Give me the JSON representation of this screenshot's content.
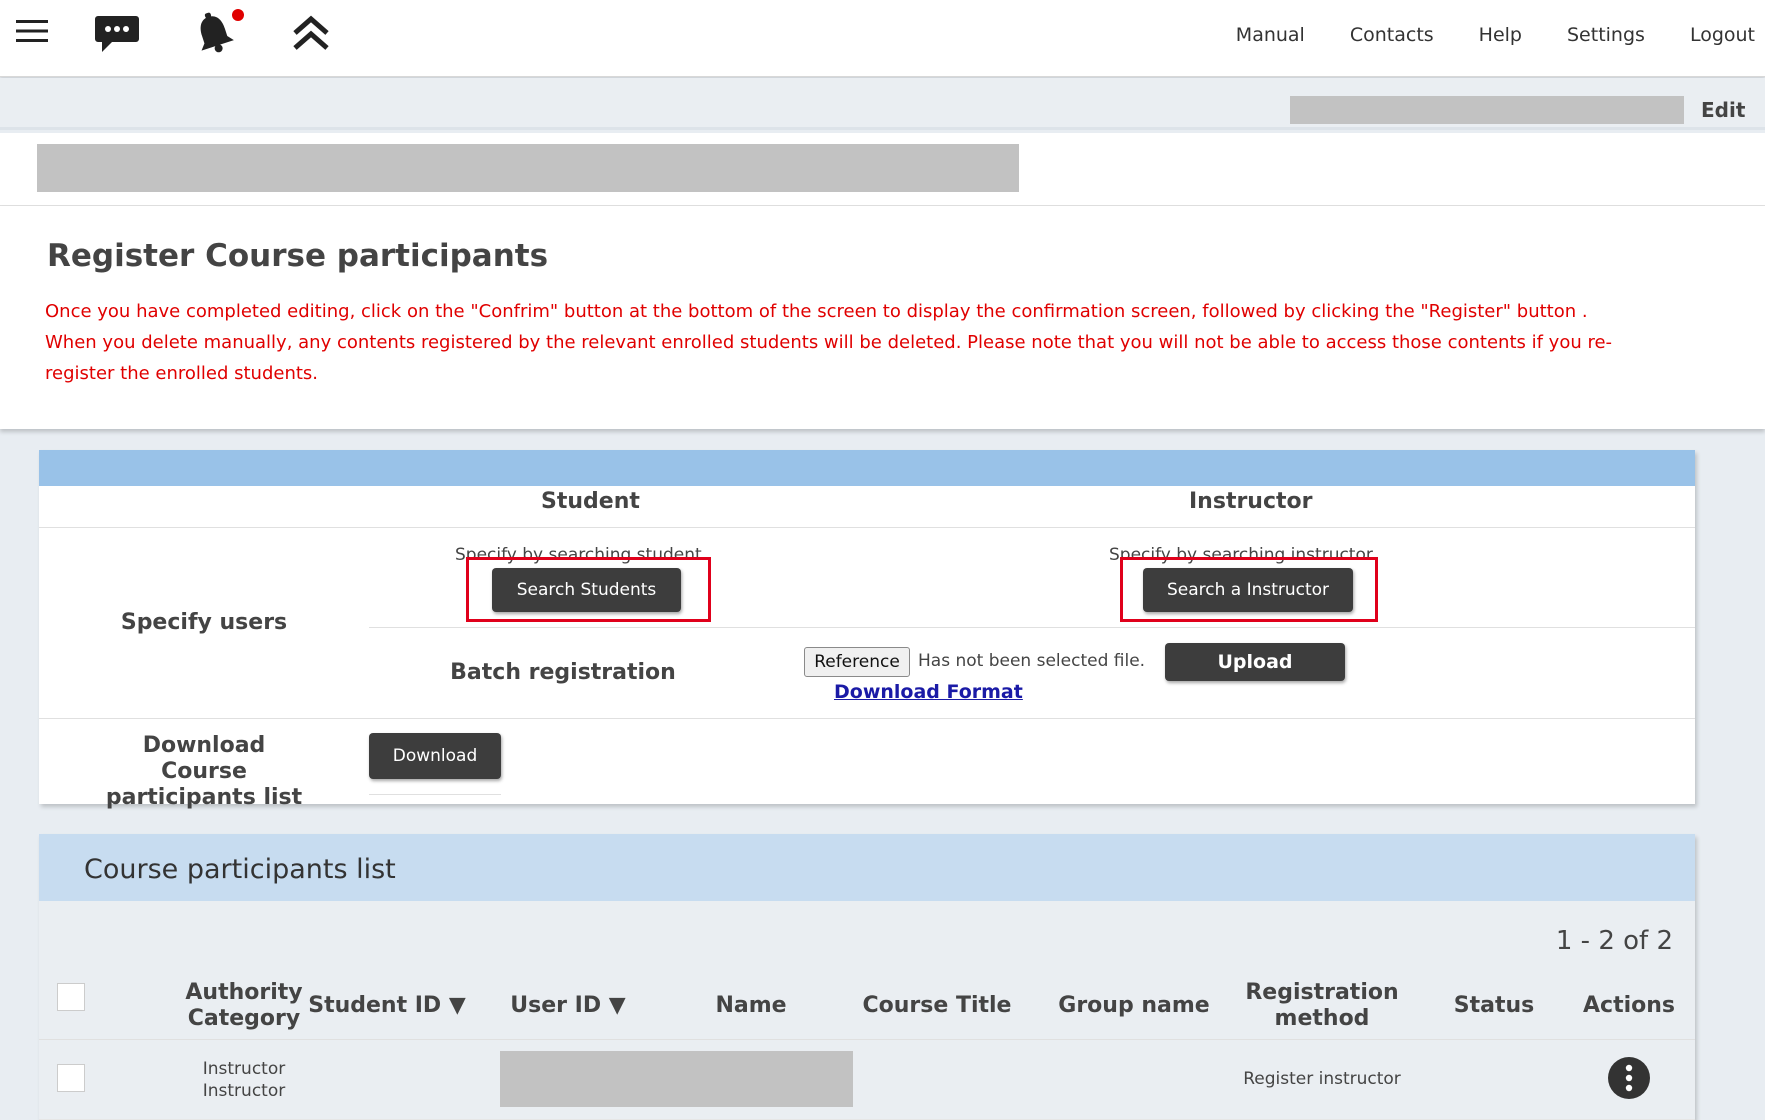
{
  "nav": {
    "links": [
      {
        "name": "nav-manual",
        "label": "Manual"
      },
      {
        "name": "nav-contacts",
        "label": "Contacts"
      },
      {
        "name": "nav-help",
        "label": "Help"
      },
      {
        "name": "nav-settings",
        "label": "Settings"
      },
      {
        "name": "nav-logout",
        "label": "Logout"
      }
    ],
    "icons": [
      "hamburger-menu-icon",
      "chat-bubble-icon",
      "notification-bell-icon",
      "double-chevron-up-icon"
    ],
    "notification_dot_color": "#e00000"
  },
  "subbar": {
    "edit_label": "Edit"
  },
  "page": {
    "title": "Register Course participants",
    "notice_lines": [
      "Once you have completed editing, click on the \"Confrim\" button at the bottom of the screen to display the confirmation screen, followed by clicking the \"Register\" button .",
      "When you delete manually, any contents registered by the relevant enrolled students will be deleted. Please note that you will not be able to access those contents if you re-register the enrolled students."
    ],
    "notice_color": "#e00000"
  },
  "specify": {
    "col_student": "Student",
    "col_instructor": "Instructor",
    "row_label": "Specify users",
    "student_hint": "Specify by searching student",
    "student_button": "Search Students",
    "instructor_hint": "Specify by searching instructor",
    "instructor_button": "Search a Instructor",
    "batch_label": "Batch registration",
    "reference_button": "Reference",
    "file_status": "Has not been selected file.",
    "upload_button": "Upload",
    "download_format_link": "Download Format",
    "download_label": "Download Course participants list",
    "download_button": "Download",
    "highlight_color": "#e0001b"
  },
  "list": {
    "title": "Course participants list",
    "page_count": "1 - 2 of 2",
    "columns": [
      "Authority Category",
      "Student ID ▼",
      "User ID ▼",
      "Name",
      "Course Title",
      "Group name",
      "Registration method",
      "Status",
      "Actions"
    ],
    "rows": [
      {
        "authority_category": "Instructor Instructor",
        "student_id": "",
        "course_title": "",
        "group_name": "",
        "registration_method": "Register instructor",
        "status": ""
      }
    ]
  }
}
